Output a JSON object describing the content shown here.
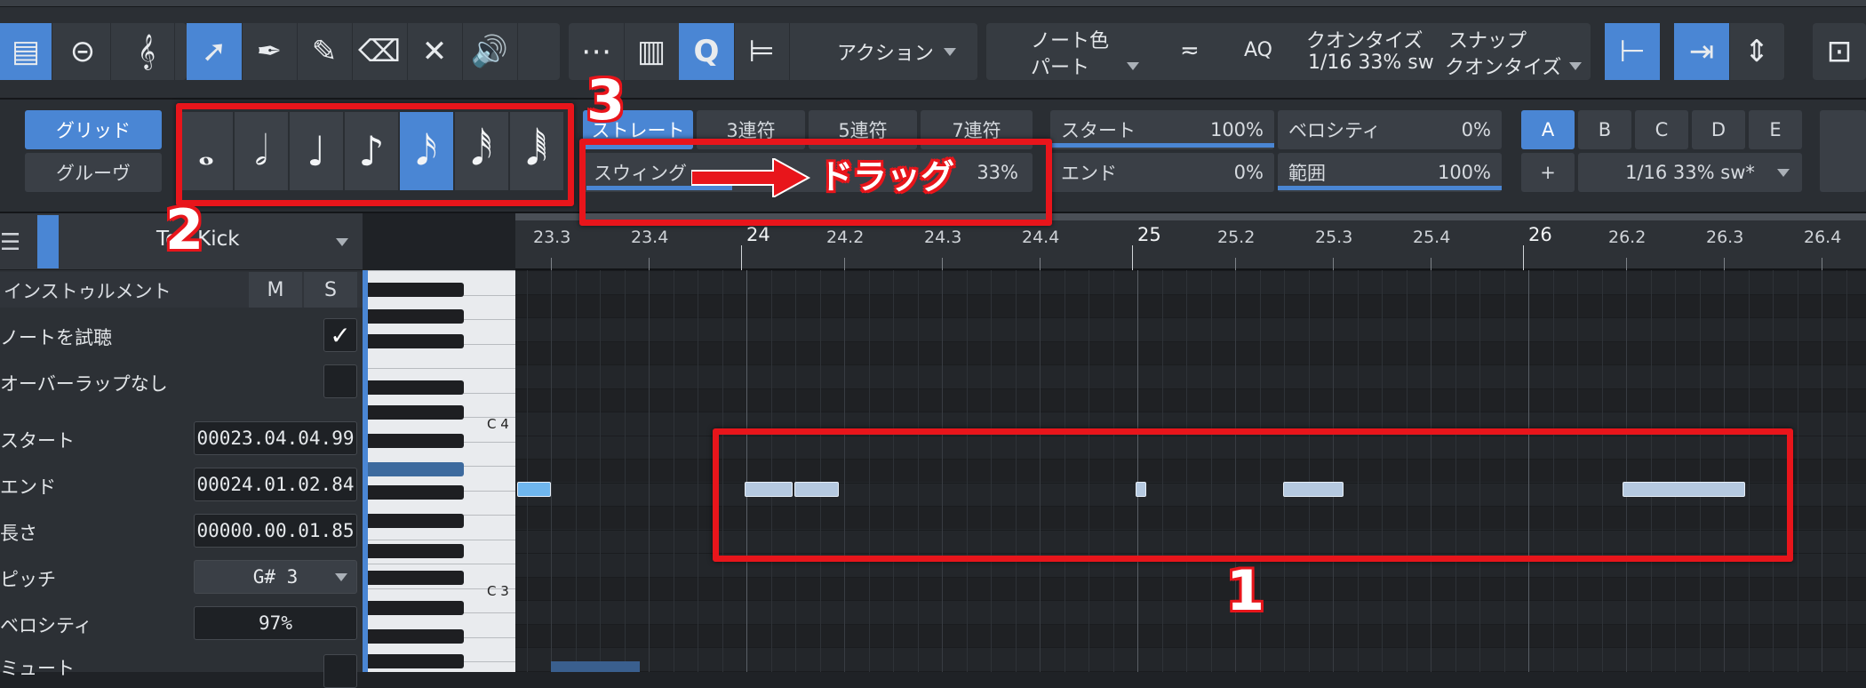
{
  "toolbar": {
    "action_label": "アクション",
    "note_color_label": "ノート色",
    "note_color_value": "パート",
    "aq_label": "AQ",
    "quantize_label": "クオンタイズ",
    "quantize_value": "1/16 33% sw",
    "snap_label": "スナップ",
    "snap_value": "クオンタイズ"
  },
  "quantize_panel": {
    "grid_label": "グリッド",
    "groove_label": "グルーヴ",
    "straight_label": "ストレート",
    "triplet_label": "3連符",
    "quintuplet_label": "5連符",
    "septuplet_label": "7連符",
    "swing_label": "スウィング",
    "swing_value": "33%",
    "swing_fraction": 0.33,
    "start_label": "スタート",
    "start_value": "100%",
    "end_label": "エンド",
    "end_value": "0%",
    "velocity_label": "ベロシティ",
    "velocity_value": "0%",
    "range_label": "範囲",
    "range_value": "100%",
    "presets": [
      "A",
      "B",
      "C",
      "D",
      "E"
    ],
    "preset_add": "+",
    "preset_value": "1/16 33% sw*"
  },
  "inspector": {
    "track_name": "Top Kick",
    "instrument_label": "インストゥルメント",
    "mute_label": "M",
    "solo_label": "S",
    "audition_label": "ノートを試聴",
    "no_overlap_label": "オーバーラップなし",
    "start_label": "スタート",
    "start_value": "00023.04.04.99",
    "end_label": "エンド",
    "end_value": "00024.01.02.84",
    "length_label": "長さ",
    "length_value": "00000.00.01.85",
    "pitch_label": "ピッチ",
    "pitch_value": "G# 3",
    "velocity_label": "ベロシティ",
    "velocity_value": "97%",
    "mute_row_label": "ミュート"
  },
  "keyboard": {
    "c4": "C 4",
    "c3": "C 3"
  },
  "ruler": [
    "23.3",
    "23.4",
    "24",
    "24.2",
    "24.3",
    "24.4",
    "25",
    "25.2",
    "25.3",
    "25.4",
    "26",
    "26.2",
    "26.3",
    "26.4"
  ],
  "annotations": {
    "one": "1",
    "two": "2",
    "three": "3",
    "drag": "ドラッグ"
  },
  "colors": {
    "accent": "#4a86d4",
    "annotation": "#e8151b",
    "note": "#b5c9e0"
  }
}
